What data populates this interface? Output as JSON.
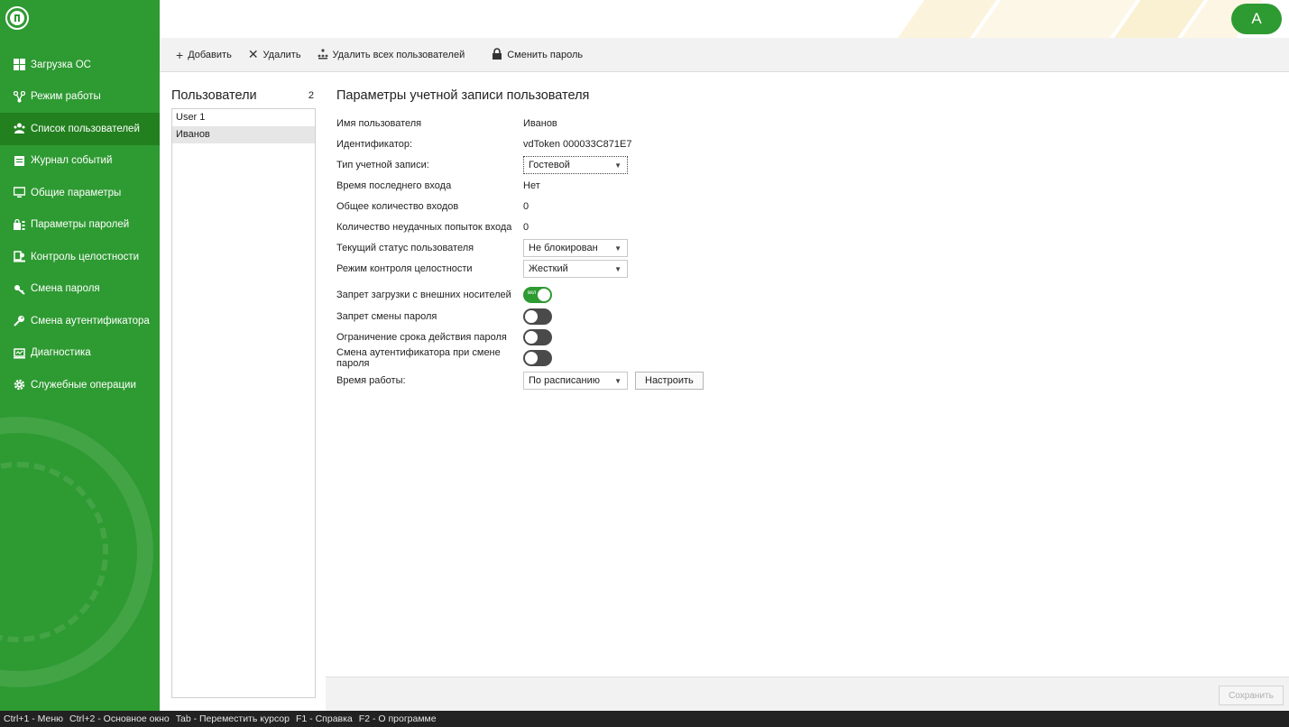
{
  "topbar": {
    "avatar_letter": "A",
    "accent": "#2e9a32"
  },
  "sidebar": {
    "items": [
      {
        "label": "Загрузка ОС",
        "icon": "grid-icon"
      },
      {
        "label": "Режим работы",
        "icon": "network-icon"
      },
      {
        "label": "Список пользователей",
        "icon": "users-icon"
      },
      {
        "label": "Журнал событий",
        "icon": "journal-icon"
      },
      {
        "label": "Общие параметры",
        "icon": "monitor-icon"
      },
      {
        "label": "Параметры паролей",
        "icon": "password-params-icon"
      },
      {
        "label": "Контроль целостности",
        "icon": "integrity-icon"
      },
      {
        "label": "Смена пароля",
        "icon": "key-change-icon"
      },
      {
        "label": "Смена аутентификатора",
        "icon": "key-icon"
      },
      {
        "label": "Диагностика",
        "icon": "diagnostics-icon"
      },
      {
        "label": "Служебные операции",
        "icon": "gear-icon"
      }
    ],
    "active_index": 2
  },
  "toolbar": {
    "add_label": "Добавить",
    "delete_label": "Удалить",
    "delete_all_label": "Удалить всех пользователей",
    "change_password_label": "Сменить пароль"
  },
  "users": {
    "title": "Пользователи",
    "count": "2",
    "list": [
      "User 1",
      "Иванов"
    ],
    "selected_index": 1
  },
  "params": {
    "title": "Параметры учетной записи пользователя",
    "username_label": "Имя пользователя",
    "username_value": "Иванов",
    "id_label": "Идентификатор:",
    "id_value": "vdToken 000033C871E7",
    "account_type_label": "Тип учетной записи:",
    "account_type_value": "Гостевой",
    "last_login_label": "Время последнего входа",
    "last_login_value": "Нет",
    "total_logins_label": "Общее количество входов",
    "total_logins_value": "0",
    "failed_logins_label": "Количество неудачных попыток входа",
    "failed_logins_value": "0",
    "status_label": "Текущий статус пользователя",
    "status_value": "Не блокирован",
    "integrity_mode_label": "Режим контроля целостности",
    "integrity_mode_value": "Жесткий",
    "ext_boot_label": "Запрет загрузки с внешних носителей",
    "ext_boot_on": true,
    "ext_boot_toggle_text": "вкл",
    "pwd_change_label": "Запрет смены пароля",
    "pwd_change_on": false,
    "pwd_expiry_label": "Ограничение срока действия пароля",
    "pwd_expiry_on": false,
    "auth_change_label": "Смена аутентификатора при смене пароля",
    "auth_change_on": false,
    "work_time_label": "Время работы:",
    "work_time_value": "По расписанию",
    "configure_label": "Настроить"
  },
  "footer": {
    "save_label": "Сохранить"
  },
  "statusbar": {
    "items": [
      "Ctrl+1 - Меню",
      "Ctrl+2 - Основное окно",
      "Tab - Переместить курсор",
      "F1 - Справка",
      "F2 - О программе"
    ]
  }
}
